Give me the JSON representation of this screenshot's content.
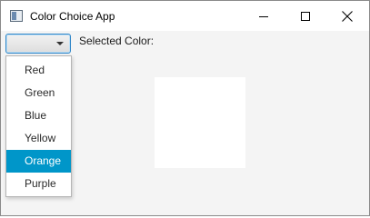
{
  "window": {
    "title": "Color Choice App"
  },
  "combo": {
    "value": ""
  },
  "selected_color": {
    "label": "Selected Color:",
    "swatch_color": "#ffffff"
  },
  "dropdown": {
    "items": [
      {
        "label": "Red",
        "selected": false
      },
      {
        "label": "Green",
        "selected": false
      },
      {
        "label": "Blue",
        "selected": false
      },
      {
        "label": "Yellow",
        "selected": false
      },
      {
        "label": "Orange",
        "selected": true
      },
      {
        "label": "Purple",
        "selected": false
      }
    ],
    "highlight_color": "#0096c9"
  },
  "icons": {
    "app": "app-window-icon",
    "minimize": "minimize-icon",
    "maximize": "maximize-icon",
    "close": "close-icon",
    "combo_arrow": "chevron-down-icon"
  }
}
